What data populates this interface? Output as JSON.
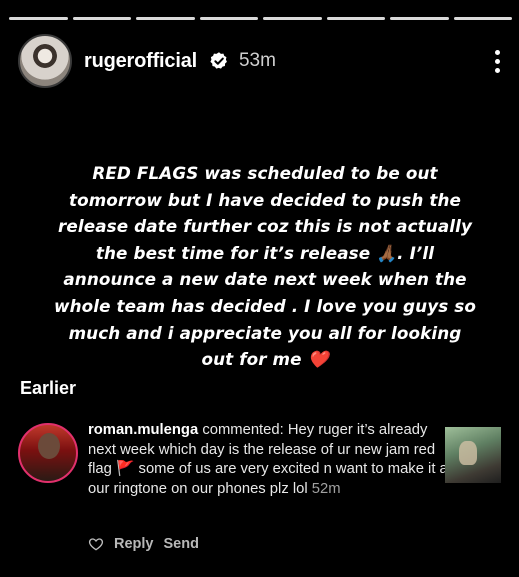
{
  "story": {
    "username": "rugerofficial",
    "time": "53m",
    "icons": {
      "verified": "verified-badge-icon",
      "more": "more-options-icon"
    },
    "text_lines": [
      "RED FLAGS was scheduled to be out",
      "tomorrow but I have decided to push the",
      "release date further coz this is not actually",
      "the best time for it’s release 🙏🏾. I’ll",
      "announce a new date next week when the",
      "whole team has decided . I love you guys so",
      "much and i appreciate you all for looking",
      "out for me ❤️"
    ]
  },
  "activity": {
    "section_title": "Earlier",
    "comment": {
      "username": "roman.mulenga",
      "text_before_flag": "commented: Hey ruger it’s already next week which day is the release of ur new jam red flag",
      "flag_emoji": "🚩",
      "text_after_flag": "some of us are very excited n want to make it as our ringtone on our phones plz lol",
      "time": "52m",
      "actions": {
        "reply": "Reply",
        "send": "Send"
      }
    }
  },
  "colors": {
    "background": "#000000",
    "text": "#ffffff",
    "muted": "#b8b8b8",
    "like": "#ffffff"
  }
}
